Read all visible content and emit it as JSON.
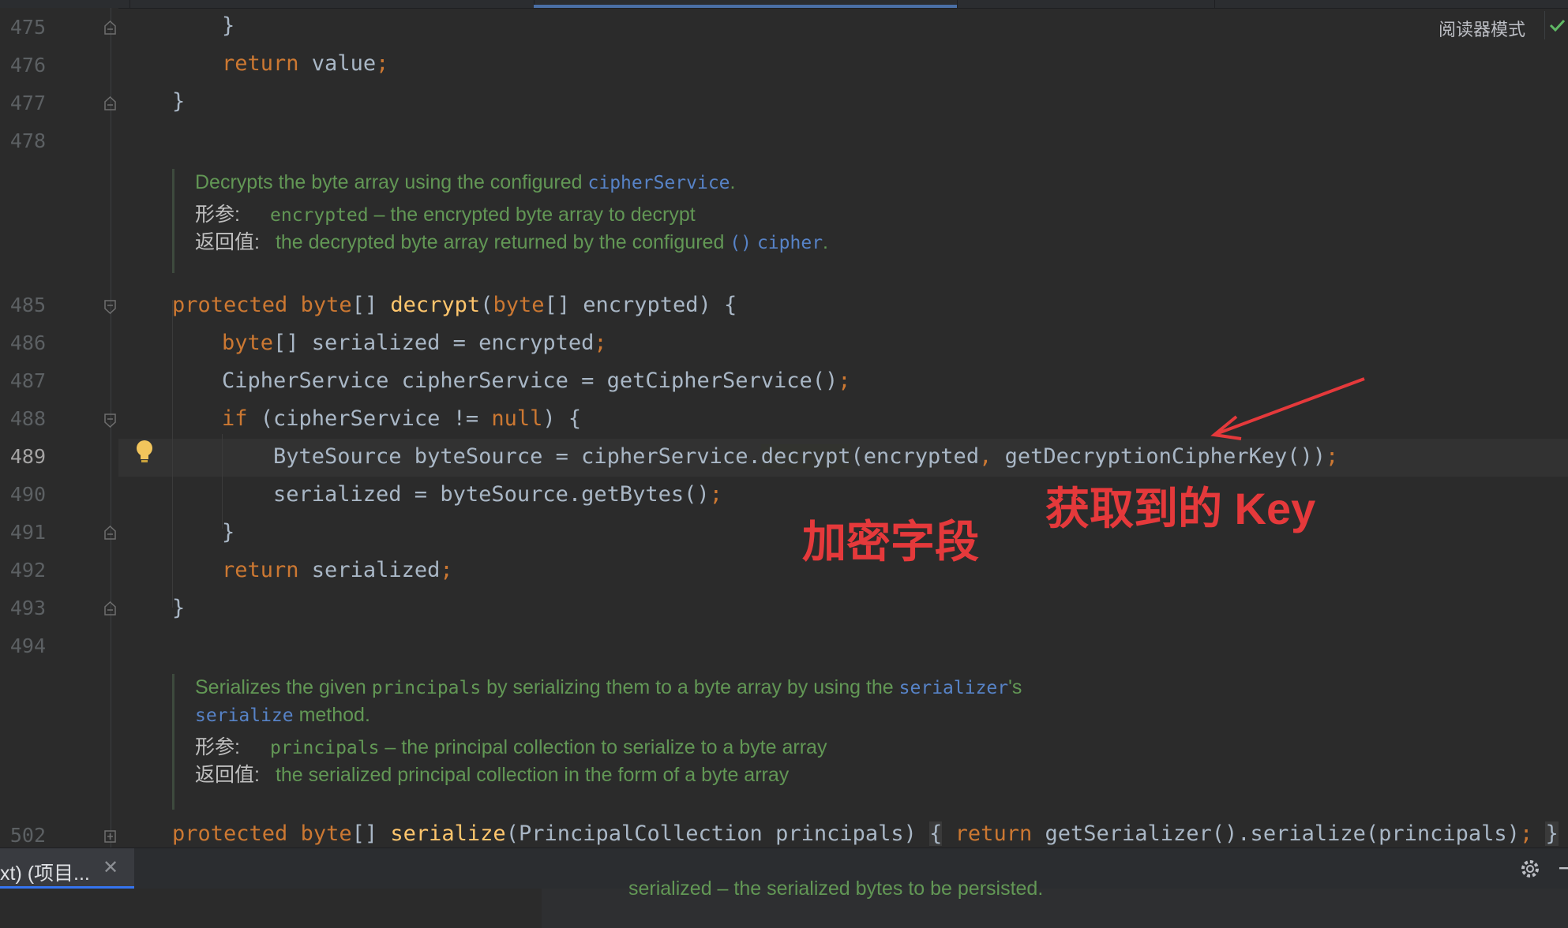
{
  "reader_mode_label": "阅读器模式",
  "line_numbers": [
    "475",
    "476",
    "477",
    "478",
    "485",
    "486",
    "487",
    "488",
    "489",
    "490",
    "491",
    "492",
    "493",
    "494",
    "502"
  ],
  "code": {
    "l475": {
      "brace": "}"
    },
    "l476": {
      "kw": "return",
      "rest": " value",
      "semi": ";"
    },
    "l477": {
      "brace": "}"
    },
    "l485": {
      "kw1": "protected",
      "kw2": "byte",
      "mid": "[] ",
      "fn": "decrypt",
      "p1": "(",
      "kw3": "byte",
      "p2": "[] encrypted) {"
    },
    "l486": {
      "kw": "byte",
      "rest": "[] serialized = encrypted",
      "semi": ";"
    },
    "l487": {
      "rest": "CipherService cipherService = getCipherService()",
      "semi": ";"
    },
    "l488": {
      "kw": "if",
      "rest1": " (cipherService != ",
      "kw2": "null",
      "rest2": ") {"
    },
    "l489": {
      "pre": "ByteSource byteSource = cipherService.",
      "hl": "decrypt",
      "post": "(encrypted",
      "comma": ",",
      "post2": " getDecryptionCipherKey())",
      "semi": ";"
    },
    "l490": {
      "rest": "serialized = byteSource.getBytes()",
      "semi": ";"
    },
    "l491": {
      "brace": "}"
    },
    "l492": {
      "kw": "return",
      "rest": " serialized",
      "semi": ";"
    },
    "l493": {
      "brace": "}"
    },
    "l502": {
      "kw1": "protected",
      "kw2": "byte",
      "mid": "[] ",
      "fn": "serialize",
      "p1": "(PrincipalCollection principals) ",
      "fold_open": "{",
      "sp": " ",
      "kw3": "return",
      "p2": " getSerializer().serialize(principals)",
      "semi": ";",
      "sp2": " ",
      "fold_close": "}"
    }
  },
  "doc1": {
    "line1_pre": "Decrypts the byte array using the configured ",
    "line1_link": "cipherService",
    "line1_post": ".",
    "param_label": "形参:",
    "param_name": "encrypted",
    "param_desc": " – the encrypted byte array to decrypt",
    "return_label": "返回值:",
    "return_pre": " the decrypted byte array returned by the configured ",
    "return_link1": "()",
    "return_space": " ",
    "return_link2": "cipher",
    "return_post": "."
  },
  "doc2": {
    "line1_pre": "Serializes the given ",
    "line1_mono": "principals",
    "line1_mid": " by serializing them to a byte array by using the ",
    "line1_link": "serializer",
    "line1_post": "'s",
    "line2_link": "serialize",
    "line2_post": " method.",
    "param_label": "形参:",
    "param_name": "principals",
    "param_desc": " – the principal collection to serialize to a byte array",
    "return_label": "返回值:",
    "return_desc": " the serialized principal collection in the form of a byte array"
  },
  "annotations": {
    "key_label": "获取到的 Key",
    "field_label": "加密字段"
  },
  "bottom_tab": {
    "label": "xt) (项目...",
    "close": "✕"
  },
  "below_text": "serialized – the serialized bytes to be persisted.",
  "colors": {
    "keyword": "#cc7832",
    "function": "#ffc66d",
    "doc": "#629755",
    "link": "#5783c7",
    "annotation": "#e5393b"
  }
}
